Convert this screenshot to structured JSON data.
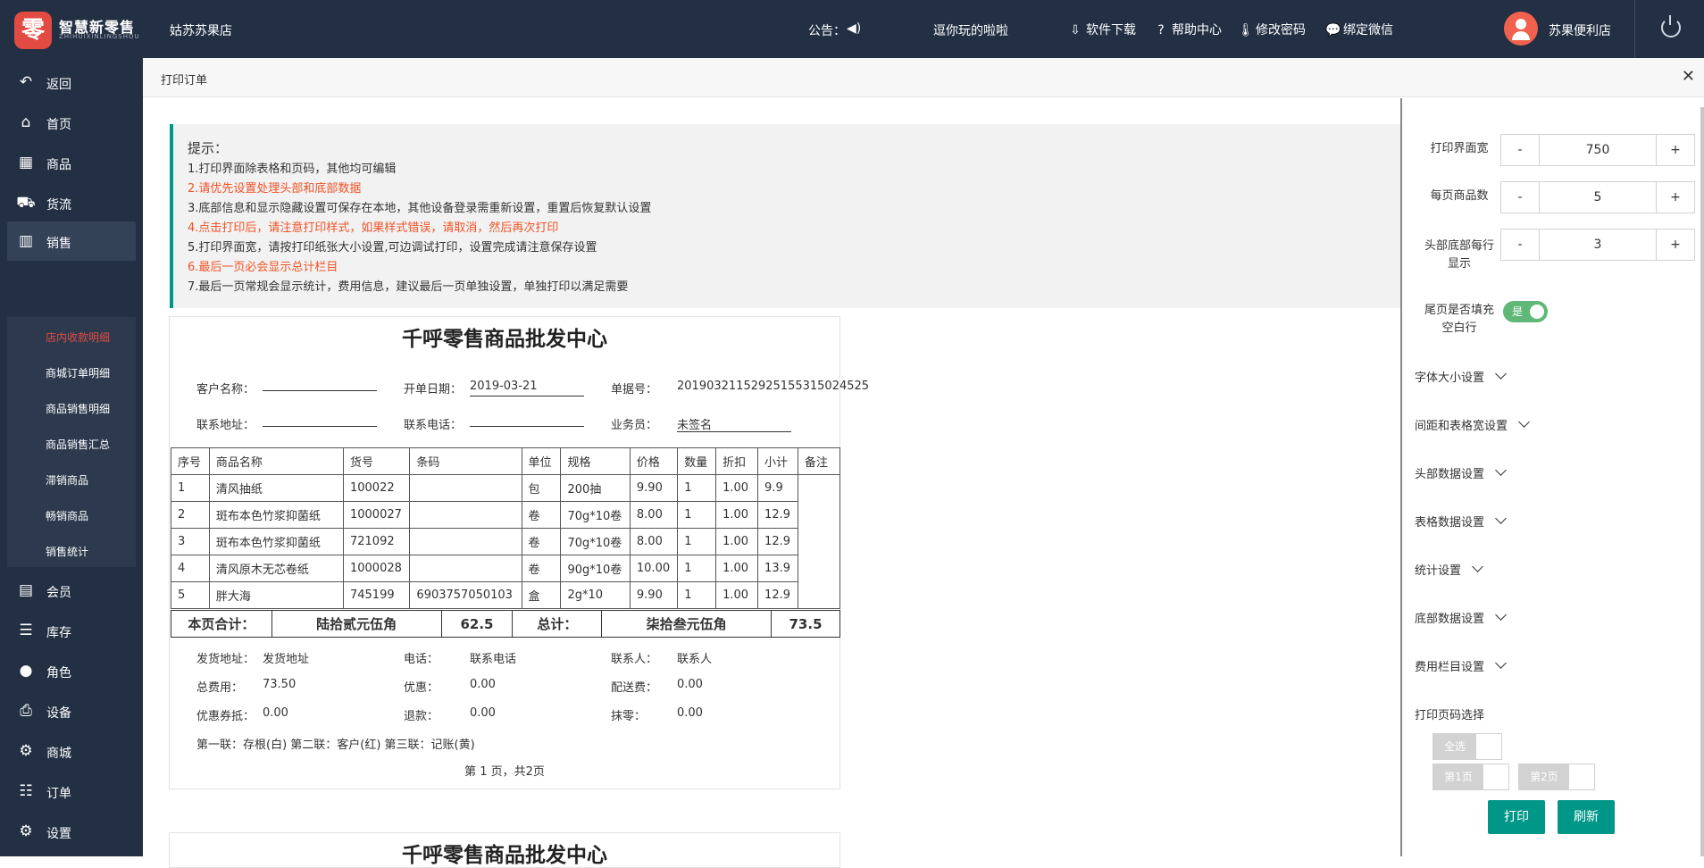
{
  "header": {
    "logo_glyph": "零",
    "logo_name": "智慧新零售",
    "logo_sub": "ZHIHUIXINLINGSHOU",
    "store": "姑苏苏果店",
    "notice_label": "公告：",
    "notice_text": "逗你玩的啦啦",
    "links": {
      "download": "软件下载",
      "help": "帮助中心",
      "password": "修改密码",
      "wechat": "绑定微信"
    },
    "user": "苏果便利店"
  },
  "sidebar": {
    "items": [
      {
        "label": "返回",
        "icon": "back-icon"
      },
      {
        "label": "首页",
        "icon": "home-icon"
      },
      {
        "label": "商品",
        "icon": "grid-icon"
      },
      {
        "label": "货流",
        "icon": "truck-icon"
      },
      {
        "label": "销售",
        "icon": "bar-chart-icon"
      },
      {
        "label": "会员",
        "icon": "id-card-icon"
      },
      {
        "label": "库存",
        "icon": "database-icon"
      },
      {
        "label": "角色",
        "icon": "user-icon"
      },
      {
        "label": "设备",
        "icon": "printer-icon"
      },
      {
        "label": "商城",
        "icon": "gear-icon"
      },
      {
        "label": "订单",
        "icon": "list-icon"
      },
      {
        "label": "设置",
        "icon": "gear-icon"
      }
    ],
    "sub_items": [
      "店内收款明细",
      "商城订单明细",
      "商品销售明细",
      "商品销售汇总",
      "滞销商品",
      "畅销商品",
      "销售统计"
    ]
  },
  "tab": {
    "title": "打印订单",
    "close": "✕"
  },
  "tips": {
    "title": "提示：",
    "lines": [
      "1.打印界面除表格和页码，其他均可编辑",
      "2.请优先设置处理头部和底部数据",
      "3.底部信息和显示隐藏设置可保存在本地，其他设备登录需重新设置，重置后恢复默认设置",
      "4.点击打印后，请注意打印样式，如果样式错误，请取消，然后再次打印",
      "5.打印界面宽，请按打印纸张大小设置,可边调试打印，设置完成请注意保存设置",
      "6.最后一页必会显示总计栏目",
      "7.最后一页常规会显示统计，费用信息，建议最后一页单独设置，单独打印以满足需要"
    ]
  },
  "sheet": {
    "title": "千呼零售商品批发中心",
    "customer_label": "客户名称：",
    "date_label": "开单日期：",
    "date_value": "2019-03-21",
    "doc_label": "单据号：",
    "doc_value": "20190321152925155315024525",
    "address_label": "联系地址：",
    "phone_label": "联系电话：",
    "staff_label": "业务员：",
    "staff_value": "未签名",
    "columns": [
      "序号",
      "商品名称",
      "货号",
      "条码",
      "单位",
      "规格",
      "价格",
      "数量",
      "折扣",
      "小计",
      "备注"
    ],
    "rows": [
      [
        "1",
        "清风抽纸",
        "100022",
        "",
        "包",
        "200抽",
        "9.90",
        "1",
        "1.00",
        "9.9"
      ],
      [
        "2",
        "斑布本色竹浆抑菌纸",
        "1000027",
        "",
        "卷",
        "70g*10卷",
        "8.00",
        "1",
        "1.00",
        "12.9"
      ],
      [
        "3",
        "斑布本色竹浆抑菌纸",
        "721092",
        "",
        "卷",
        "70g*10卷",
        "8.00",
        "1",
        "1.00",
        "12.9"
      ],
      [
        "4",
        "清风原木无芯卷纸",
        "1000028",
        "",
        "卷",
        "90g*10卷",
        "10.00",
        "1",
        "1.00",
        "13.9"
      ],
      [
        "5",
        "胖大海",
        "745199",
        "6903757050103",
        "盒",
        "2g*10",
        "9.90",
        "1",
        "1.00",
        "12.9"
      ]
    ],
    "sum": {
      "page_label": "本页合计：",
      "page_words": "陆拾贰元伍角",
      "page_value": "62.5",
      "total_label": "总计：",
      "total_words": "柒拾叁元伍角",
      "total_value": "73.5"
    },
    "footer": {
      "ship_label": "发货地址：",
      "ship_value": "发货地址",
      "tel_label": "电话：",
      "tel_value": "联系电话",
      "contact_label": "联系人：",
      "contact_value": "联系人",
      "fee_label": "总费用：",
      "fee_value": "73.50",
      "discount_label": "优惠：",
      "discount_value": "0.00",
      "delivery_label": "配送费：",
      "delivery_value": "0.00",
      "coupon_label": "优惠券抵：",
      "coupon_value": "0.00",
      "refund_label": "退款：",
      "refund_value": "0.00",
      "round_label": "抹零：",
      "round_value": "0.00",
      "copies": "第一联：存根(白) 第二联：客户(红) 第三联：记账(黄)",
      "page_no": "第 1 页，共2页"
    }
  },
  "panel": {
    "width_label": "打印界面宽",
    "width_value": "750",
    "per_page_label": "每页商品数",
    "per_page_value": "5",
    "header_rows_label": "头部底部每行显示",
    "header_rows_value": "3",
    "minus": "-",
    "plus": "+",
    "fill_label": "尾页是否填充空白行",
    "fill_value": "是",
    "sections": [
      "字体大小设置",
      "间距和表格宽设置",
      "头部数据设置",
      "表格数据设置",
      "统计设置",
      "底部数据设置",
      "费用栏目设置"
    ],
    "page_select_label": "打印页码选择",
    "select_all": "全选",
    "page1": "第1页",
    "page2": "第2页",
    "print": "打印",
    "refresh": "刷新"
  }
}
